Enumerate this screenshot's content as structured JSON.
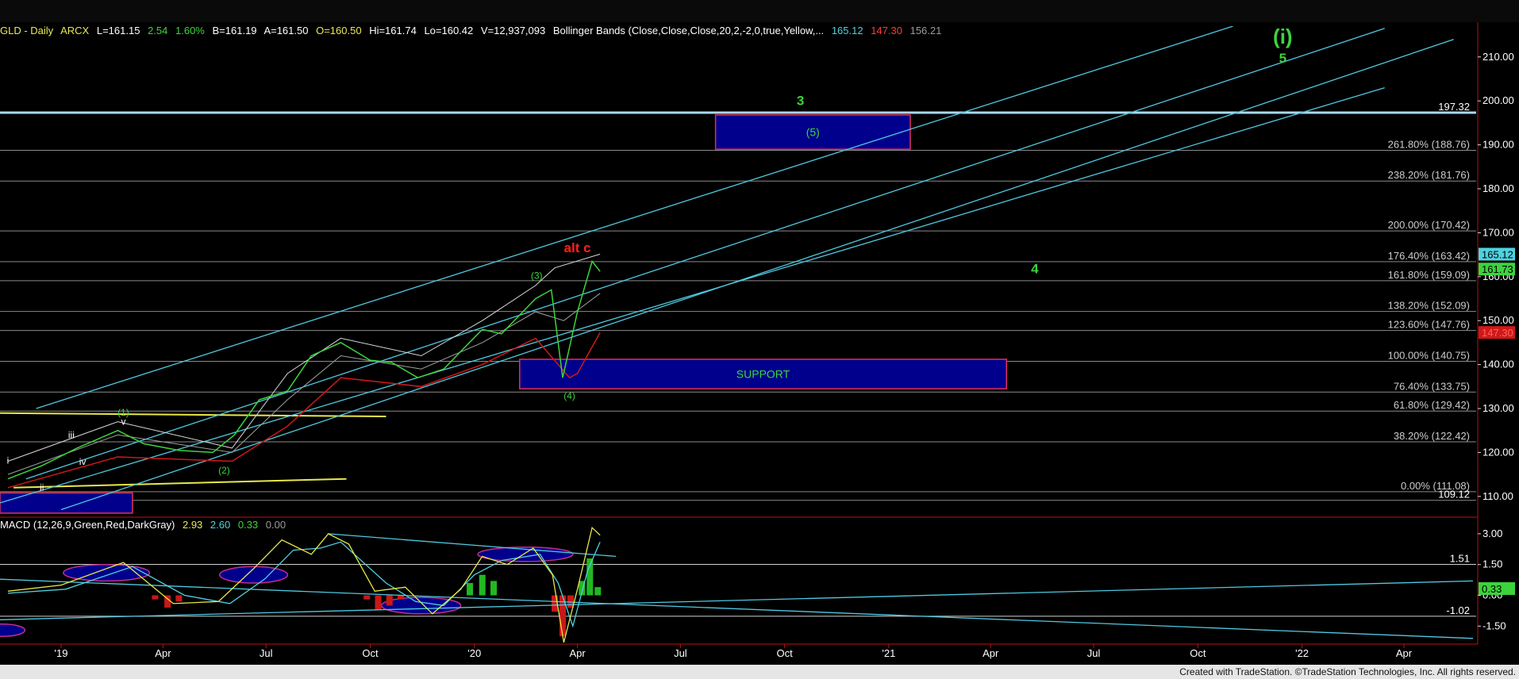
{
  "header": {
    "symbol": "GLD - Daily",
    "exchange": "ARCX",
    "last": "L=161.15",
    "change": "2.54",
    "change_pct": "1.60%",
    "bid": "B=161.19",
    "ask": "A=161.50",
    "open": "O=160.50",
    "high": "Hi=161.74",
    "low": "Lo=160.42",
    "volume": "V=12,937,093",
    "indicator": "Bollinger Bands (Close,Close,Close,20,2,-2,0,true,Yellow,...",
    "bb_upper": "165.12",
    "bb_lower": "147.30",
    "bb_mid": "156.21"
  },
  "macd_header": {
    "label": "MACD (12,26,9,Green,Red,DarkGray)",
    "macd": "2.93",
    "signal": "2.60",
    "diff": "0.33",
    "zero": "0.00"
  },
  "credit": "Created with TradeStation. ©TradeStation Technologies, Inc. All rights reserved.",
  "colors": {
    "background": "#000000",
    "price": "#3cd43c",
    "bollinger": "#d8d8d8",
    "bollinger_lower": "#d01818",
    "channel": "#4fc8e0",
    "box_fill": "#00008c",
    "box_border": "#e0305a",
    "fib_line": "#8a8a8a",
    "yellow_line": "#e8e84a",
    "wave_green": "#3cd43c",
    "wave_red": "#ff2020"
  },
  "chart_data": [
    {
      "type": "line",
      "title": "GLD - Daily",
      "ylim": [
        106,
        217
      ],
      "x_ticks": [
        "'19",
        "Apr",
        "Jul",
        "Oct",
        "'20",
        "Apr",
        "Jul",
        "Oct",
        "'21",
        "Apr",
        "Jul",
        "Oct",
        "'22",
        "Apr"
      ],
      "y_ticks": [
        "110.00",
        "120.00",
        "130.00",
        "140.00",
        "150.00",
        "160.00",
        "170.00",
        "180.00",
        "190.00",
        "200.00",
        "210.00"
      ],
      "y_tick_values": [
        110,
        120,
        130,
        140,
        150,
        160,
        170,
        180,
        190,
        200,
        210
      ],
      "series": [
        {
          "name": "GLD",
          "x": [
            "2018-11-15",
            "2018-12-15",
            "2019-01-15",
            "2019-02-20",
            "2019-03-15",
            "2019-04-15",
            "2019-05-15",
            "2019-06-03",
            "2019-06-25",
            "2019-07-20",
            "2019-08-10",
            "2019-09-05",
            "2019-10-01",
            "2019-10-20",
            "2019-11-12",
            "2019-12-05",
            "2019-12-20",
            "2020-01-08",
            "2020-01-25",
            "2020-02-24",
            "2020-03-09",
            "2020-03-19",
            "2020-04-01",
            "2020-04-14",
            "2020-04-21"
          ],
          "values": [
            114,
            117,
            121,
            125,
            122,
            120.5,
            120,
            124,
            132,
            134,
            142,
            145,
            141,
            140.5,
            137,
            139,
            143,
            148,
            147,
            155,
            157,
            137,
            152,
            163.5,
            161.2
          ]
        }
      ],
      "bollinger_upper": {
        "x": [
          "2018-11-15",
          "2019-02-20",
          "2019-06-01",
          "2019-07-20",
          "2019-09-05",
          "2019-11-15",
          "2020-01-08",
          "2020-02-24",
          "2020-03-12",
          "2020-04-21"
        ],
        "values": [
          118,
          127,
          121,
          138,
          146,
          142,
          150,
          158,
          162,
          165.12
        ]
      },
      "bollinger_mid": {
        "x": [
          "2018-11-15",
          "2019-02-20",
          "2019-06-01",
          "2019-07-20",
          "2019-09-05",
          "2019-11-15",
          "2020-01-08",
          "2020-02-24",
          "2020-03-20",
          "2020-04-21"
        ],
        "values": [
          115,
          124,
          120,
          132,
          142,
          139,
          145,
          152,
          150,
          156.21
        ]
      },
      "bollinger_lower": {
        "x": [
          "2018-11-15",
          "2019-02-20",
          "2019-06-01",
          "2019-07-20",
          "2019-09-05",
          "2019-11-15",
          "2020-01-08",
          "2020-02-24",
          "2020-03-25",
          "2020-04-01",
          "2020-04-21"
        ],
        "values": [
          112,
          119,
          118,
          126,
          137,
          135,
          140,
          146,
          137,
          138,
          147.3
        ]
      },
      "channel_lines": [
        {
          "x": [
            "2018-12-10",
            "2021-11-01"
          ],
          "values": [
            130,
            217
          ]
        },
        {
          "x": [
            "2018-12-01",
            "2022-03-15"
          ],
          "values": [
            114,
            216.5
          ]
        },
        {
          "x": [
            "2018-11-01",
            "2022-03-15"
          ],
          "values": [
            108,
            203
          ]
        },
        {
          "x": [
            "2019-01-01",
            "2022-05-15"
          ],
          "values": [
            107,
            214
          ]
        }
      ],
      "yellow_lines": [
        {
          "x": [
            "2018-11-01",
            "2019-10-15"
          ],
          "values": [
            129,
            128.2
          ]
        },
        {
          "x": [
            "2018-11-20",
            "2019-09-10"
          ],
          "values": [
            112,
            114
          ]
        }
      ],
      "levels": [
        {
          "label": "197.32",
          "value": 197.32,
          "note": "horizontal resistance"
        },
        {
          "label": "261.80% (188.76)",
          "value": 188.76
        },
        {
          "label": "238.20% (181.76)",
          "value": 181.76
        },
        {
          "label": "200.00% (170.42)",
          "value": 170.42
        },
        {
          "label": "176.40% (163.42)",
          "value": 163.42
        },
        {
          "label": "161.80% (159.09)",
          "value": 159.09
        },
        {
          "label": "138.20% (152.09)",
          "value": 152.09
        },
        {
          "label": "123.60% (147.76)",
          "value": 147.76
        },
        {
          "label": "100.00% (140.75)",
          "value": 140.75
        },
        {
          "label": "76.40% (133.75)",
          "value": 133.75
        },
        {
          "label": "61.80% (129.42)",
          "value": 129.42
        },
        {
          "label": "38.20% (122.42)",
          "value": 122.42
        },
        {
          "label": "0.00% (111.08)",
          "value": 111.08
        },
        {
          "label": "109.12",
          "value": 109.12
        }
      ],
      "price_tags": [
        {
          "label": "165.12",
          "value": 165.12,
          "color": "#4fd2e0"
        },
        {
          "label": "161.73",
          "value": 161.73,
          "color": "#3cd43c"
        },
        {
          "label": "147.30",
          "value": 147.3,
          "color": "#d01818"
        }
      ],
      "boxes": [
        {
          "label": "(5)",
          "x0": "2020-08-01",
          "x1": "2021-01-20",
          "y0": 189,
          "y1": 196.8
        },
        {
          "label": "SUPPORT",
          "x0": "2020-02-10",
          "x1": "2021-04-15",
          "y0": 134.5,
          "y1": 141.2
        },
        {
          "label": "",
          "x0": "2018-11-01",
          "x1": "2019-03-05",
          "y0": 106.2,
          "y1": 110.8
        }
      ],
      "annotations": [
        {
          "text": "(i)",
          "x": "2021-12-15",
          "y": 213,
          "color": "#3cd43c"
        },
        {
          "text": "5",
          "x": "2021-12-15",
          "y": 208.7,
          "color": "#3cd43c"
        },
        {
          "text": "3",
          "x": "2020-10-15",
          "y": 199,
          "color": "#3cd43c"
        },
        {
          "text": "4",
          "x": "2021-05-10",
          "y": 160.8,
          "color": "#3cd43c"
        },
        {
          "text": "alt c",
          "x": "2020-04-01",
          "y": 165.6,
          "color": "#ff2020"
        },
        {
          "text": "(3)",
          "x": "2020-02-25",
          "y": 159.5,
          "color": "#3cd43c"
        },
        {
          "text": "(4)",
          "x": "2020-03-25",
          "y": 132.2,
          "color": "#3cd43c"
        },
        {
          "text": "(1)",
          "x": "2019-02-25",
          "y": 128.4,
          "color": "#3cd43c"
        },
        {
          "text": "v",
          "x": "2019-02-25",
          "y": 126.3,
          "color": "#ffffff"
        },
        {
          "text": "iii",
          "x": "2019-01-10",
          "y": 123.2,
          "color": "#ffffff"
        },
        {
          "text": "iv",
          "x": "2019-01-20",
          "y": 117.2,
          "color": "#ffffff"
        },
        {
          "text": "(2)",
          "x": "2019-05-25",
          "y": 115.2,
          "color": "#3cd43c"
        },
        {
          "text": "i",
          "x": "2018-11-15",
          "y": 117.5,
          "color": "#ffffff"
        },
        {
          "text": "ii",
          "x": "2018-12-15",
          "y": 111.3,
          "color": "#ffffff"
        }
      ]
    },
    {
      "type": "line",
      "title": "MACD (12,26,9,Green,Red,DarkGray)",
      "ylim": [
        -2.3,
        3.5
      ],
      "y_ticks": [
        "3.00",
        "1.50",
        "0.00",
        "-1.50"
      ],
      "y_tick_values": [
        3.0,
        1.5,
        0.0,
        -1.5
      ],
      "levels": [
        {
          "label": "1.51",
          "value": 1.51
        },
        {
          "label": "-1.02",
          "value": -1.02
        }
      ],
      "price_tags": [
        {
          "label": "0.33",
          "value": 0.33,
          "color": "#3cd43c"
        }
      ],
      "series": [
        {
          "name": "MACD",
          "x": [
            "2018-11-15",
            "2019-01-01",
            "2019-02-25",
            "2019-04-10",
            "2019-05-20",
            "2019-06-20",
            "2019-07-15",
            "2019-08-10",
            "2019-08-25",
            "2019-09-12",
            "2019-10-05",
            "2019-11-01",
            "2019-11-25",
            "2019-12-20",
            "2020-01-08",
            "2020-01-30",
            "2020-02-22",
            "2020-03-10",
            "2020-03-20",
            "2020-04-01",
            "2020-04-14",
            "2020-04-21"
          ],
          "values": [
            0.2,
            0.5,
            1.6,
            -0.4,
            -0.3,
            1.3,
            2.7,
            2.0,
            3.0,
            2.5,
            0.2,
            0.4,
            -0.9,
            0.3,
            1.9,
            1.5,
            2.3,
            1.0,
            -2.3,
            0.3,
            3.3,
            2.93
          ]
        },
        {
          "name": "Signal",
          "x": [
            "2018-11-15",
            "2019-01-05",
            "2019-03-05",
            "2019-04-20",
            "2019-05-30",
            "2019-06-30",
            "2019-07-25",
            "2019-08-18",
            "2019-09-05",
            "2019-10-15",
            "2019-11-10",
            "2019-12-05",
            "2020-01-01",
            "2020-01-25",
            "2020-02-28",
            "2020-03-15",
            "2020-03-28",
            "2020-04-10",
            "2020-04-21"
          ],
          "values": [
            0.1,
            0.3,
            1.4,
            0.0,
            -0.4,
            0.8,
            2.2,
            2.3,
            2.6,
            0.6,
            -0.3,
            -0.5,
            1.0,
            1.7,
            2.0,
            0.6,
            -1.5,
            1.2,
            2.6
          ]
        }
      ],
      "histogram": {
        "x": [
          "2019-03-25",
          "2019-04-05",
          "2019-04-15",
          "2019-09-28",
          "2019-10-08",
          "2019-10-18",
          "2019-10-28",
          "2019-12-28",
          "2020-01-08",
          "2020-01-18",
          "2020-03-12",
          "2020-03-19",
          "2020-03-26",
          "2020-04-05",
          "2020-04-12",
          "2020-04-19"
        ],
        "values": [
          -0.2,
          -0.6,
          -0.3,
          -0.2,
          -0.7,
          -0.5,
          -0.2,
          0.6,
          1.0,
          0.7,
          -0.8,
          -2.0,
          -0.6,
          0.7,
          1.8,
          0.4
        ]
      },
      "trend_lines": [
        {
          "x": [
            "2019-08-25",
            "2020-05-05"
          ],
          "values": [
            3.0,
            1.9
          ]
        },
        {
          "x": [
            "2018-11-01",
            "2022-06-01"
          ],
          "values": [
            -1.2,
            0.7
          ]
        },
        {
          "x": [
            "2018-11-01",
            "2022-06-01"
          ],
          "values": [
            0.8,
            -2.1
          ]
        }
      ],
      "ellipses": [
        {
          "cx": "2019-02-10",
          "cy": 1.1,
          "rx_days": 38,
          "ry": 0.8
        },
        {
          "cx": "2019-06-20",
          "cy": 1.0,
          "rx_days": 30,
          "ry": 0.8
        },
        {
          "cx": "2019-11-15",
          "cy": -0.5,
          "rx_days": 35,
          "ry": 0.8
        },
        {
          "cx": "2020-02-15",
          "cy": 2.0,
          "rx_days": 42,
          "ry": 0.7
        },
        {
          "cx": "2018-11-10",
          "cy": -1.7,
          "rx_days": 20,
          "ry": 0.6
        }
      ]
    }
  ]
}
